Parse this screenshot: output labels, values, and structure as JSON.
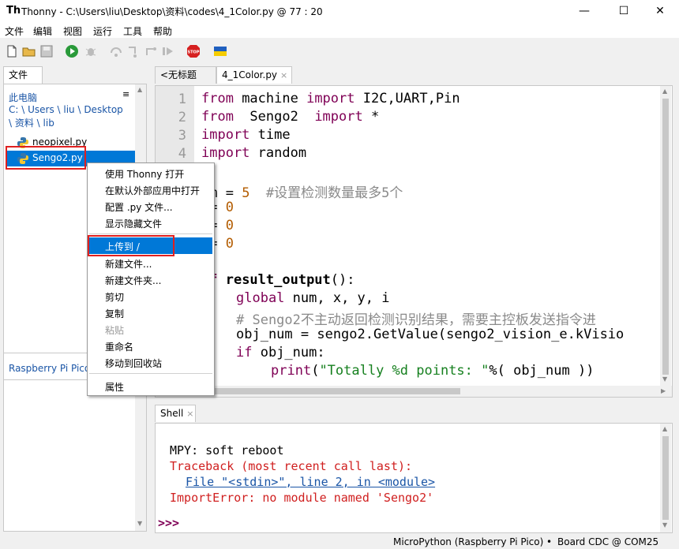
{
  "window": {
    "app_icon": "Th",
    "title": "Thonny  -  C:\\Users\\liu\\Desktop\\资料\\codes\\4_1Color.py  @  77 : 20",
    "controls": [
      "minimize",
      "maximize",
      "close"
    ]
  },
  "menu": [
    "文件",
    "编辑",
    "视图",
    "运行",
    "工具",
    "帮助"
  ],
  "toolbar_icons": [
    "new-file-icon",
    "open-folder-icon",
    "save-icon",
    "run-icon",
    "debug-icon",
    "step-over-icon",
    "step-into-icon",
    "step-out-icon",
    "resume-icon",
    "stop-icon",
    "ukraine-flag-icon"
  ],
  "stop_label": "STOP",
  "file_pane": {
    "tab_label": "文件",
    "section_label": "此电脑",
    "path": "C: \\ Users \\ liu \\ Desktop \\ 资料 \\ lib",
    "files": [
      "neopixel.py",
      "Sengo2.py"
    ],
    "device_label": "Raspberry Pi Pico"
  },
  "editor": {
    "tabs": [
      {
        "label": "<无标题>"
      },
      {
        "label": "4_1Color.py"
      }
    ],
    "line_numbers": [
      "1",
      "2",
      "3",
      "4"
    ]
  },
  "code": {
    "l1": {
      "a": "from",
      "b": " machine ",
      "c": "import",
      "d": " I2C,UART,Pin"
    },
    "l2": {
      "a": "from",
      "b": "  Sengo2  ",
      "c": "import",
      "d": " *"
    },
    "l3": {
      "a": "import",
      "b": " time"
    },
    "l4": {
      "a": "import",
      "b": " random"
    },
    "l6": {
      "a": "um = ",
      "b": "5",
      "c": "  #设置检测数量最多5个"
    },
    "l7": {
      "a": " = ",
      "b": "0"
    },
    "l8": {
      "a": " = ",
      "b": "0"
    },
    "l9": {
      "a": " = ",
      "b": "0"
    },
    "l11": {
      "a": "ef ",
      "b": "result_output",
      "c": "():"
    },
    "l12": {
      "a": "global",
      "b": " num, x, y, i"
    },
    "l13": {
      "a": "# Sengo2不主动返回检测识别结果，需要主控板发送指令进"
    },
    "l14": {
      "a": "obj_num = sengo2.GetValue(sengo2_vision_e.kVisio"
    },
    "l15": {
      "a": "if",
      "b": " obj_num:"
    },
    "l16": {
      "a": "print",
      "b": "(",
      "c": "\"Totally %d points: \"",
      "d": "%( obj_num ))"
    }
  },
  "shell": {
    "tab_label": "Shell",
    "lines": {
      "l1": "MPY: soft reboot",
      "l2": "Traceback (most recent call last):",
      "l3": "File \"<stdin>\", line 2, in <module>",
      "l4": "ImportError: no module named 'Sengo2'"
    },
    "prompt": ">>>"
  },
  "context_menu": {
    "items": [
      "使用 Thonny 打开",
      "在默认外部应用中打开",
      "配置 .py 文件...",
      "显示隐藏文件",
      "上传到 /",
      "新建文件...",
      "新建文件夹...",
      "剪切",
      "复制",
      "粘贴",
      "重命名",
      "移动到回收站",
      "属性"
    ]
  },
  "statusbar": {
    "interpreter": "MicroPython (Raspberry Pi Pico)",
    "sep": "•",
    "port": "Board CDC @ COM25"
  },
  "colors": {
    "keyword": "#7f0055",
    "number": "#b35c00",
    "comment": "#8a8a8a",
    "string": "#16801f",
    "error": "#d02020",
    "link": "#1a55a6",
    "selection": "#0078d7",
    "highlight_box": "#e02020"
  }
}
